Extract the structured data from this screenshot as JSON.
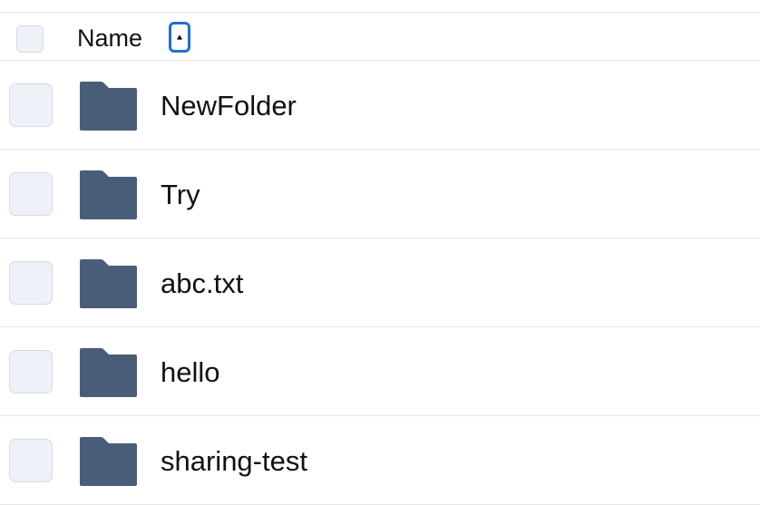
{
  "header": {
    "name_label": "Name",
    "sort_direction": "ascending",
    "sort_icon": "caret-up-icon"
  },
  "colors": {
    "folder": "#4a5d78",
    "focus_ring": "#1f6fd6",
    "checkbox_fill": "#eef2f8",
    "checkbox_border": "#d3dbe7",
    "divider": "#e3e5e8"
  },
  "rows": [
    {
      "name": "NewFolder",
      "icon": "folder-icon"
    },
    {
      "name": "Try",
      "icon": "folder-icon"
    },
    {
      "name": "abc.txt",
      "icon": "folder-icon"
    },
    {
      "name": "hello",
      "icon": "folder-icon"
    },
    {
      "name": "sharing-test",
      "icon": "folder-icon"
    }
  ]
}
